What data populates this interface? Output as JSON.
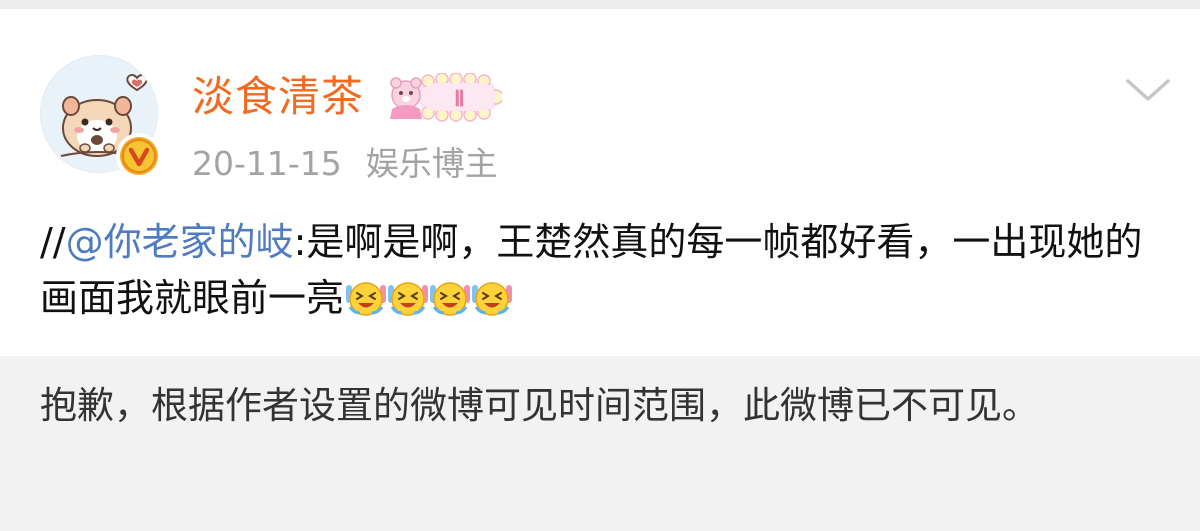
{
  "post": {
    "author": {
      "name": "淡食清茶",
      "avatar": "hamster-avatar",
      "verified_icon": "verified-v-badge",
      "member_badge_level": "Ⅱ"
    },
    "date": "20-11-15",
    "source": "娱乐博主",
    "content": {
      "prefix": "//",
      "mention": "@你老家的岐",
      "text": ":是啊是啊，王楚然真的每一帧都好看，一出现她的画面我就眼前一亮",
      "emoji_count": 4,
      "emoji_name": "laughing-tears-emoji"
    },
    "notice": "抱歉，根据作者设置的微博可见时间范围，此微博已不可见。"
  },
  "colors": {
    "author_name": "#f26a21",
    "mention": "#4f7cc0",
    "meta": "#a3a3a3",
    "background": "#f2f2f2"
  }
}
